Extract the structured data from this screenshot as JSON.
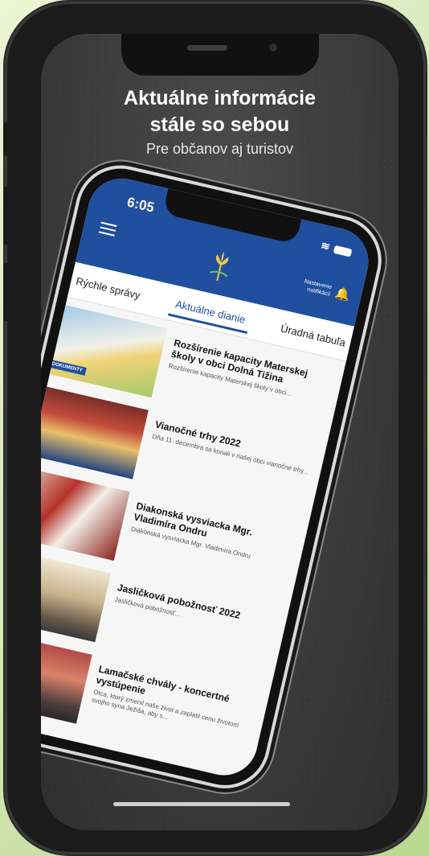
{
  "promo": {
    "headline_line1": "Aktuálne informácie",
    "headline_line2": "stále so sebou",
    "subheadline": "Pre občanov aj turistov"
  },
  "app": {
    "status_time": "6:05",
    "notifications_label_line1": "Nastavenie",
    "notifications_label_line2": "notifikácií",
    "tabs": [
      {
        "label": "Rýchle správy",
        "active": false
      },
      {
        "label": "Aktuálne dianie",
        "active": true
      },
      {
        "label": "Úradná tabuľa",
        "active": false
      }
    ],
    "news": [
      {
        "title": "Rozšírenie kapacity Materskej školy v obci Dolná Tižina",
        "description": "Rozšírenie kapacity Materskej školy v obci...",
        "badge": "DOKUMENTY"
      },
      {
        "title": "Vianočné trhy 2022",
        "description": "Dňa 11. decembra sa konali v našej obci vianočné trhy...",
        "badge": ""
      },
      {
        "title": "Diakonská vysviacka Mgr. Vladimíra Ondru",
        "description": "Diakonská vysviacka Mgr. Vladimíra Ondru",
        "badge": ""
      },
      {
        "title": "Jasličková pobožnosť 2022",
        "description": "Jasličková pobožnosť...",
        "badge": ""
      },
      {
        "title": "Lamačské chvály - koncertné vystúpenie",
        "description": "Otca, ktorý zmenil naše život a zaplatil cenu životom svojho syna Ježiša, aby s...",
        "badge": ""
      }
    ]
  },
  "colors": {
    "brand_blue": "#1f4f9e",
    "background_green": "#c9e2a6",
    "phone_frame": "#1b1b1b"
  }
}
